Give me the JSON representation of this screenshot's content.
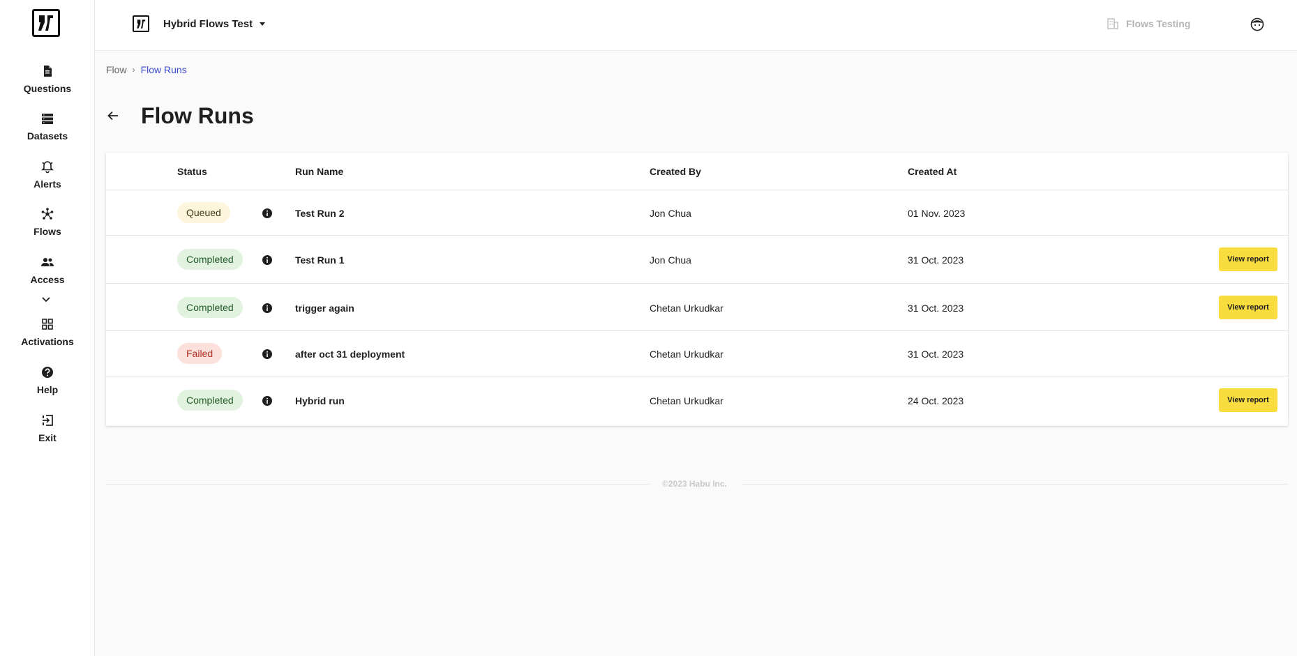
{
  "sidebar": {
    "items": [
      {
        "label": "Questions",
        "icon": "document-icon"
      },
      {
        "label": "Datasets",
        "icon": "database-icon"
      },
      {
        "label": "Alerts",
        "icon": "bell-icon"
      },
      {
        "label": "Flows",
        "icon": "flows-icon"
      },
      {
        "label": "Access",
        "icon": "people-icon"
      },
      {
        "label": "Activations",
        "icon": "grid-icon"
      },
      {
        "label": "Help",
        "icon": "help-icon"
      },
      {
        "label": "Exit",
        "icon": "exit-icon"
      }
    ]
  },
  "header": {
    "workspace": "Hybrid Flows Test",
    "organization": "Flows Testing"
  },
  "breadcrumb": {
    "parent": "Flow",
    "separator": "›",
    "current": "Flow Runs"
  },
  "page": {
    "title": "Flow Runs"
  },
  "table": {
    "columns": {
      "status": "Status",
      "run_name": "Run Name",
      "created_by": "Created By",
      "created_at": "Created At"
    },
    "action_label": "View report",
    "rows": [
      {
        "status": "Queued",
        "status_type": "queued",
        "run_name": "Test Run 2",
        "created_by": "Jon Chua",
        "created_at": "01 Nov. 2023",
        "has_report": false
      },
      {
        "status": "Completed",
        "status_type": "completed",
        "run_name": "Test Run 1",
        "created_by": "Jon Chua",
        "created_at": "31 Oct. 2023",
        "has_report": true
      },
      {
        "status": "Completed",
        "status_type": "completed",
        "run_name": "trigger again",
        "created_by": "Chetan Urkudkar",
        "created_at": "31 Oct. 2023",
        "has_report": true
      },
      {
        "status": "Failed",
        "status_type": "failed",
        "run_name": "after oct 31 deployment",
        "created_by": "Chetan Urkudkar",
        "created_at": "31 Oct. 2023",
        "has_report": false
      },
      {
        "status": "Completed",
        "status_type": "completed",
        "run_name": "Hybrid run",
        "created_by": "Chetan Urkudkar",
        "created_at": "24 Oct. 2023",
        "has_report": true
      }
    ]
  },
  "colors": {
    "accent": "#f9dc3d",
    "link": "#3a4bcf",
    "queued_bg": "#fdf6dc",
    "completed_bg": "#e1f3df",
    "failed_bg": "#fbe0dc"
  },
  "footer": {
    "copyright": "©2023 Habu Inc."
  }
}
